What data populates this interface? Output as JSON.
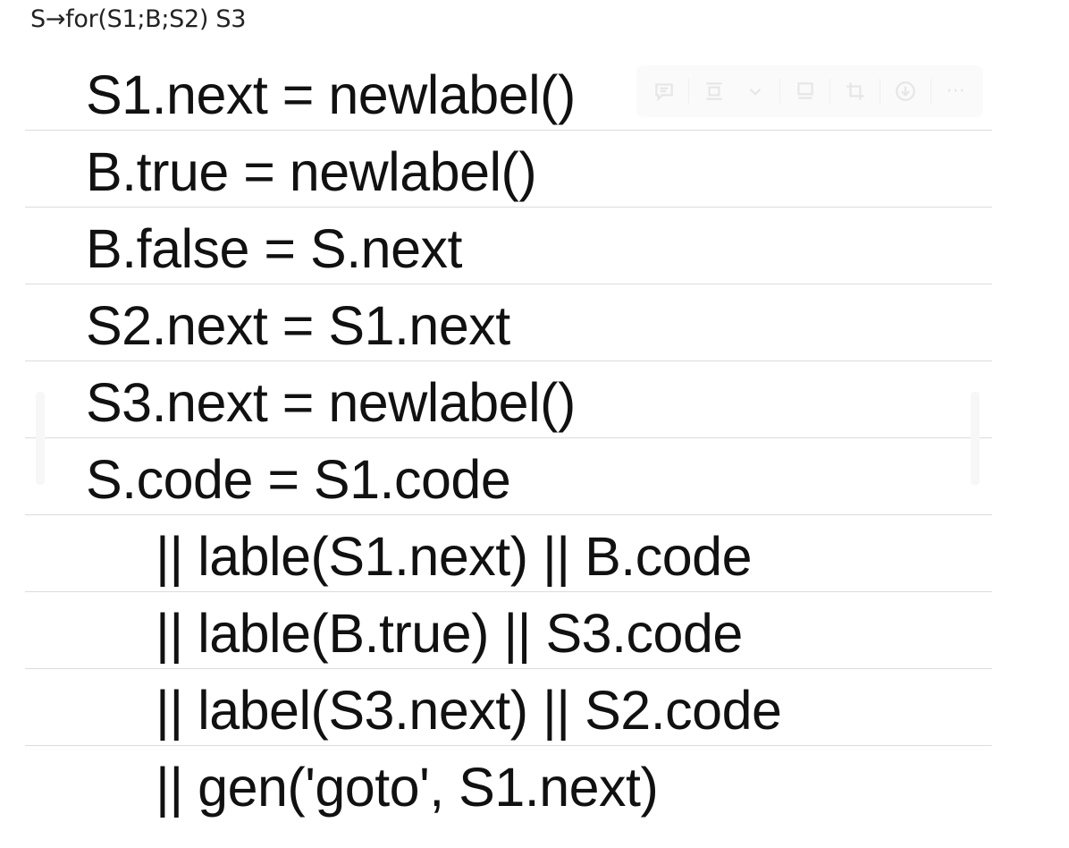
{
  "heading": "S→for(S1;B;S2) S3",
  "rows": [
    {
      "text": "S1.next = newlabel()",
      "indent": false
    },
    {
      "text": "B.true = newlabel()",
      "indent": false
    },
    {
      "text": "B.false = S.next",
      "indent": false
    },
    {
      "text": "S2.next = S1.next",
      "indent": false
    },
    {
      "text": "S3.next = newlabel()",
      "indent": false
    },
    {
      "text": "S.code = S1.code",
      "indent": false
    },
    {
      "text": "|| lable(S1.next) || B.code",
      "indent": true
    },
    {
      "text": "|| lable(B.true) || S3.code",
      "indent": true
    },
    {
      "text": "|| label(S3.next) || S2.code",
      "indent": true
    },
    {
      "text": "|| gen('goto', S1.next)",
      "indent": true
    }
  ],
  "toolbar": {
    "icons": [
      "comment-icon",
      "align-icon",
      "chevron-down-icon",
      "caption-icon",
      "crop-icon",
      "download-icon",
      "more-icon"
    ],
    "more_label": "···"
  }
}
